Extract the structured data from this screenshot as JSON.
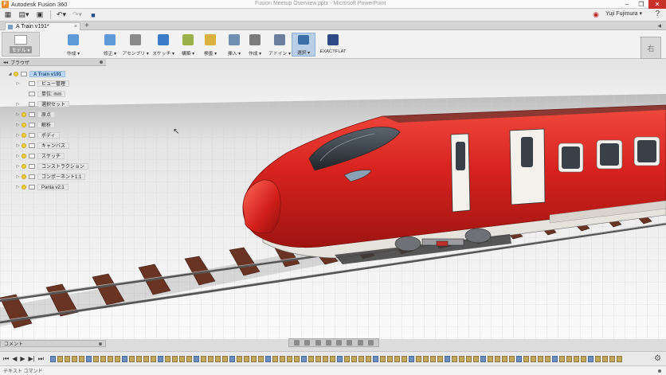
{
  "titlebar": {
    "app_title": "Autodesk Fusion 360",
    "doc_title": "Fusion Meetup Overview.pptx - Microsoft PowerPoint"
  },
  "quickbar": {
    "user_name": "Yuji Fujimura ▾"
  },
  "document_tab": {
    "label": "A Train v191*",
    "close": "×"
  },
  "ribbon": {
    "workspace_label": "モデル ▾",
    "tools": [
      {
        "label": "作成 ▾",
        "color": "#5f9bd8"
      },
      {
        "label": "修正 ▾",
        "color": "#5f9bd8"
      },
      {
        "label": "アセンブリ ▾",
        "color": "#8a8a8a"
      },
      {
        "label": "スケッチ ▾",
        "color": "#3b7bc8"
      },
      {
        "label": "構築 ▾",
        "color": "#9bb04a"
      },
      {
        "label": "検査 ▾",
        "color": "#d9b23f"
      },
      {
        "label": "挿入 ▾",
        "color": "#6d8fb0"
      },
      {
        "label": "作成 ▾",
        "color": "#7c7c7c"
      },
      {
        "label": "アドイン ▾",
        "color": "#6b7ea0"
      },
      {
        "label": "選択 ▾",
        "color": "#3a6fa8"
      },
      {
        "label": "EXACTFLAT",
        "color": "#2b4a86"
      }
    ]
  },
  "viewcube": {
    "label": "右"
  },
  "browser": {
    "title": "ブラウザ",
    "root": "A Train v191",
    "items": [
      {
        "label": "ビュー管理"
      },
      {
        "label": "単位: mm"
      },
      {
        "label": "選択セット"
      },
      {
        "label": "原点"
      },
      {
        "label": "解析"
      },
      {
        "label": "ボディ"
      },
      {
        "label": "キャンバス"
      },
      {
        "label": "スケッチ"
      },
      {
        "label": "コンストラクション"
      },
      {
        "label": "コンポーネント1:1"
      },
      {
        "label": "Panta v2:1"
      }
    ]
  },
  "comments": {
    "title": "コメント"
  },
  "textcmd": {
    "title": "テキスト コマンド"
  },
  "colors": {
    "train_red": "#d8231f",
    "rail_brown": "#6a3424",
    "grid_bg": "#f5f5f5"
  }
}
